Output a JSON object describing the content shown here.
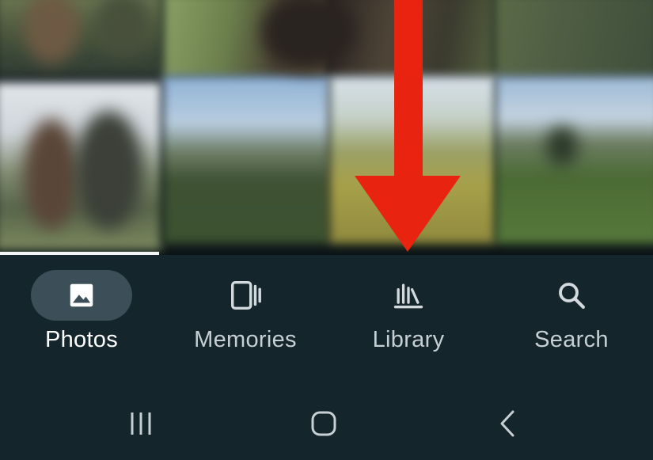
{
  "bottom_nav": {
    "items": [
      {
        "label": "Photos",
        "icon": "photo-icon",
        "active": true
      },
      {
        "label": "Memories",
        "icon": "memories-icon",
        "active": false
      },
      {
        "label": "Library",
        "icon": "library-icon",
        "active": false
      },
      {
        "label": "Search",
        "icon": "search-icon",
        "active": false
      }
    ]
  },
  "system_nav": {
    "buttons": [
      "recents-icon",
      "home-icon",
      "back-icon"
    ]
  },
  "annotation": {
    "type": "arrow",
    "color": "#e8230f",
    "direction": "down",
    "points_to": "Library"
  },
  "colors": {
    "nav_background": "#14252b",
    "active_pill": "#3c4f58",
    "label_inactive": "#c6d0d4",
    "label_active": "#ffffff"
  }
}
